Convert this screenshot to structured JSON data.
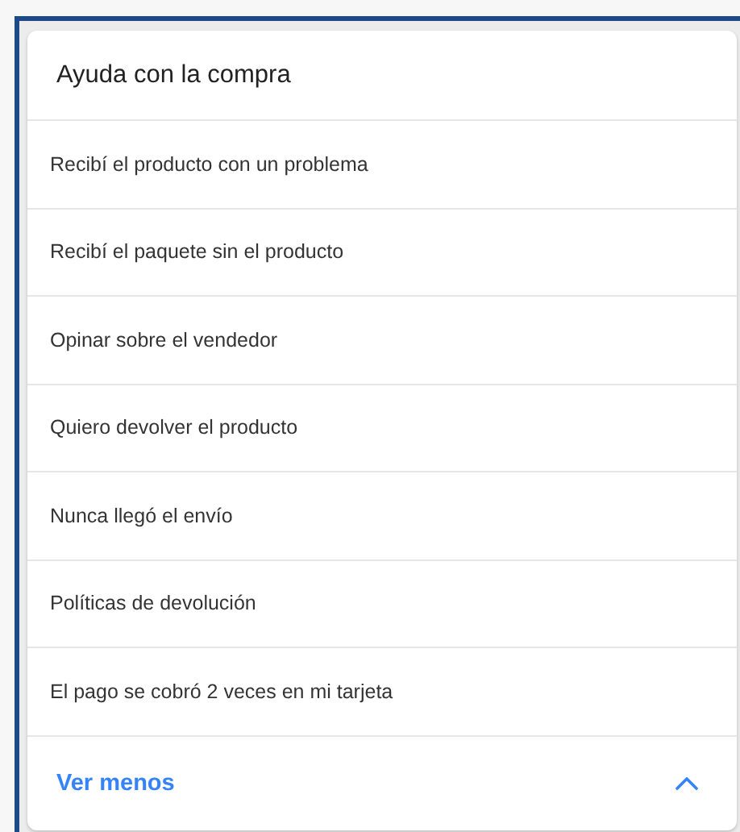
{
  "card": {
    "title": "Ayuda con la compra",
    "items": [
      "Recibí el producto con un problema",
      "Recibí el paquete sin el producto",
      "Opinar sobre el vendedor",
      "Quiero devolver el producto",
      "Nunca llegó el envío",
      "Políticas de devolución",
      "El pago se cobró 2 veces en mi tarjeta"
    ],
    "toggle": {
      "label": "Ver menos",
      "expanded": true
    }
  }
}
